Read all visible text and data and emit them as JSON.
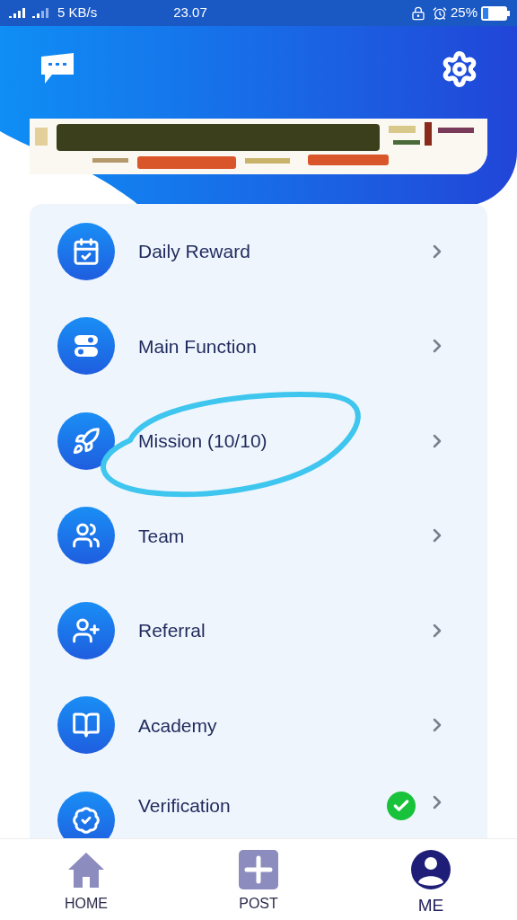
{
  "status_bar": {
    "network_speed": "5 KB/s",
    "time": "23.07",
    "battery": "25%"
  },
  "menu": [
    {
      "label": "Daily Reward",
      "kind": "calendar"
    },
    {
      "label": "Main Function",
      "kind": "toggle"
    },
    {
      "label": "Mission (10/10)",
      "kind": "rocket",
      "annotated": true
    },
    {
      "label": "Team",
      "kind": "team"
    },
    {
      "label": "Referral",
      "kind": "referral"
    },
    {
      "label": "Academy",
      "kind": "book"
    },
    {
      "label": "Verification",
      "kind": "badge",
      "verified": true
    }
  ],
  "nav": [
    {
      "label": "HOME",
      "kind": "home",
      "selected": false
    },
    {
      "label": "POST",
      "kind": "post",
      "selected": false
    },
    {
      "label": "ME",
      "kind": "me",
      "selected": true
    }
  ]
}
